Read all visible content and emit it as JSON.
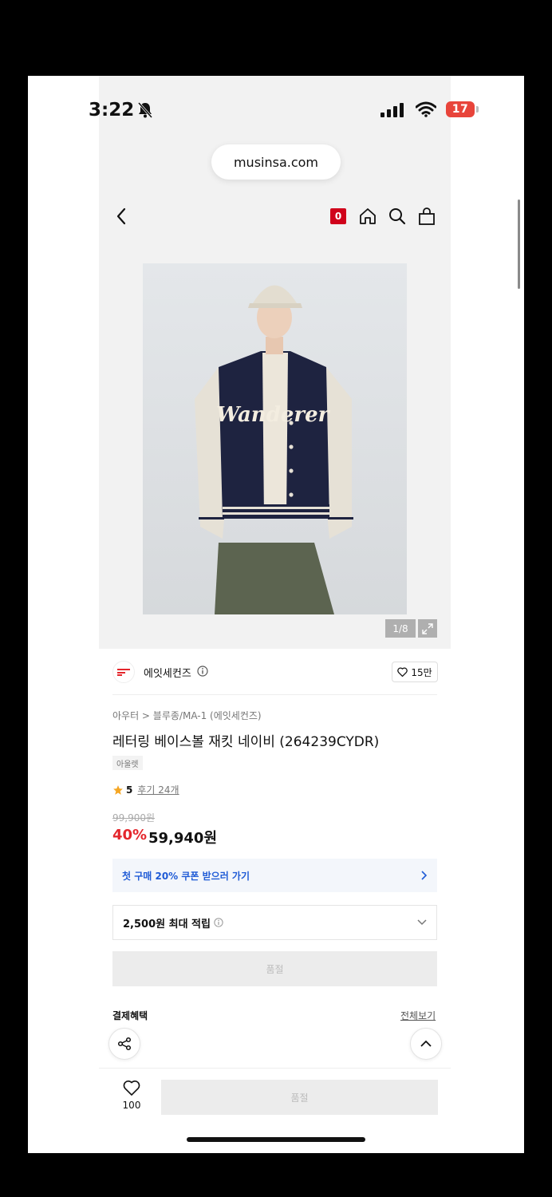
{
  "status_bar": {
    "time": "3:22",
    "battery": "17"
  },
  "browser": {
    "url": "musinsa.com"
  },
  "nav": {
    "cart_count": "0"
  },
  "gallery": {
    "counter": "1/8",
    "image_text": "Wanderer"
  },
  "brand": {
    "name": "에잇세컨즈",
    "like_count": "15만"
  },
  "product": {
    "breadcrumb": "아우터 > 블루종/MA-1 (에잇세컨즈)",
    "title": "레터링 베이스볼 재킷 네이비 (264239CYDR)",
    "tag": "아울렛",
    "rating": "5",
    "reviews": "후기 24개",
    "original_price": "99,900원",
    "discount": "40%",
    "sale_price": "59,940원"
  },
  "coupon": {
    "label": "첫 구매 20% 쿠폰 받으러 가기"
  },
  "points": {
    "label": "2,500원 최대 적립"
  },
  "soldout_button": "품절",
  "payment": {
    "title": "결제혜택",
    "see_all": "전체보기"
  },
  "bottom_bar": {
    "wish_count": "100",
    "buy_label": "품절"
  },
  "colors": {
    "accent_red": "#e4262c",
    "coupon_blue": "#1f5bd6",
    "jacket_navy": "#1e2340"
  }
}
